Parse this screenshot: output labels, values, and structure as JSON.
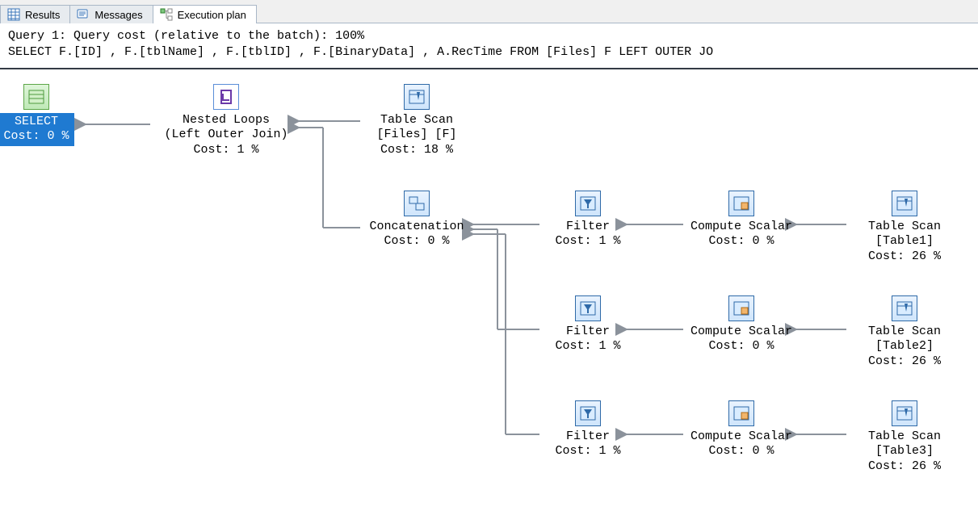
{
  "tabs": {
    "results": {
      "label": "Results"
    },
    "messages": {
      "label": "Messages"
    },
    "execplan": {
      "label": "Execution plan"
    }
  },
  "header": {
    "line1": "Query 1: Query cost (relative to the batch): 100%",
    "line2": "SELECT F.[ID] , F.[tblName] , F.[tblID] , F.[BinaryData] , A.RecTime FROM [Files] F LEFT OUTER JO"
  },
  "nodes": {
    "select": {
      "title": "SELECT",
      "sub": "",
      "cost": "Cost: 0 %"
    },
    "nestedloops": {
      "title": "Nested Loops",
      "sub": "(Left Outer Join)",
      "cost": "Cost: 1 %"
    },
    "tablescanF": {
      "title": "Table Scan",
      "sub": "[Files] [F]",
      "cost": "Cost: 18 %"
    },
    "concat": {
      "title": "Concatenation",
      "sub": "",
      "cost": "Cost: 0 %"
    },
    "filter1": {
      "title": "Filter",
      "sub": "",
      "cost": "Cost: 1 %"
    },
    "compute1": {
      "title": "Compute Scalar",
      "sub": "",
      "cost": "Cost: 0 %"
    },
    "scan1": {
      "title": "Table Scan",
      "sub": "[Table1]",
      "cost": "Cost: 26 %"
    },
    "filter2": {
      "title": "Filter",
      "sub": "",
      "cost": "Cost: 1 %"
    },
    "compute2": {
      "title": "Compute Scalar",
      "sub": "",
      "cost": "Cost: 0 %"
    },
    "scan2": {
      "title": "Table Scan",
      "sub": "[Table2]",
      "cost": "Cost: 26 %"
    },
    "filter3": {
      "title": "Filter",
      "sub": "",
      "cost": "Cost: 1 %"
    },
    "compute3": {
      "title": "Compute Scalar",
      "sub": "",
      "cost": "Cost: 0 %"
    },
    "scan3": {
      "title": "Table Scan",
      "sub": "[Table3]",
      "cost": "Cost: 26 %"
    }
  }
}
